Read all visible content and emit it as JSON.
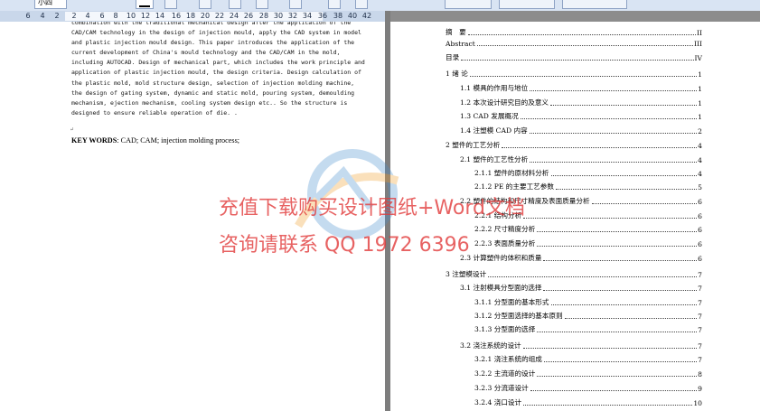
{
  "toolbar": {
    "font_size": "小四"
  },
  "ruler": {
    "ticks": [
      "6",
      "4",
      "2",
      "2",
      "4",
      "6",
      "8",
      "10",
      "12",
      "14",
      "16",
      "18",
      "20",
      "22",
      "24",
      "26",
      "28",
      "30",
      "32",
      "34",
      "36",
      "38",
      "40",
      "42"
    ]
  },
  "abstract_lines": [
    "combination with the traditional mechanical design after the application of the",
    "CAD/CAM technology in the design of injection mould, apply the CAD system in model",
    "and plastic injection mould design. This paper introduces the application of the",
    "current development of China's mould technology and the CAD/CAM in the mold,",
    "including AUTOCAD. Design of mechanical part, which includes the work principle and",
    "application of plastic injection mould, the design criteria. Design calculation of",
    "the plastic mold, mold structure design, selection of injection molding machine,",
    "the design of gating system, dynamic and static mold, pouring system, demoulding",
    "mechanism, ejection mechanism, cooling system design etc.. So the structure is",
    "designed to ensure reliable operation of die. ."
  ],
  "keywords": {
    "label": "KEY WORDS",
    "text": ": CAD; CAM; injection molding process;"
  },
  "toc": [
    {
      "label": "摘　要",
      "page": "II"
    },
    {
      "label": "Abstract",
      "page": "III"
    },
    {
      "label": "目录",
      "page": "IV"
    },
    {
      "label": "1  绪  论",
      "page": "1"
    },
    {
      "label": "1.1 模具的作用与地位",
      "page": "1"
    },
    {
      "label": "1.2  本次设计研究目的及意义",
      "page": "1"
    },
    {
      "label": "1.3 CAD 发展概况",
      "page": "1"
    },
    {
      "label": "1.4  注塑模 CAD 内容",
      "page": "2"
    },
    {
      "label": "2  塑件的工艺分析",
      "page": "4"
    },
    {
      "label": "2.1 塑件的工艺性分析",
      "page": "4"
    },
    {
      "label": "2.1.1  塑件的原材料分析",
      "page": "4"
    },
    {
      "label": "2.1.2 PE 的主要工艺参数",
      "page": "5"
    },
    {
      "label": "2.2 塑件的结构和尺寸精度及表面质量分析",
      "page": "6"
    },
    {
      "label": "2.2.1  结构分析",
      "page": "6"
    },
    {
      "label": "2.2.2  尺寸精度分析",
      "page": "6"
    },
    {
      "label": "2.2.3 表面质量分析",
      "page": "6"
    },
    {
      "label": "2.3 计算塑件的体积和质量",
      "page": "6"
    },
    {
      "label": "3 注塑模设计",
      "page": "7"
    },
    {
      "label": "3.1  注射模具分型面的选择",
      "page": "7"
    },
    {
      "label": "3.1.1  分型面的基本形式",
      "page": "7"
    },
    {
      "label": "3.1.2  分型面选择的基本原则",
      "page": "7"
    },
    {
      "label": "3.1.3  分型面的选择",
      "page": "7"
    },
    {
      "label": "3.2  浇注系统的设计",
      "page": "7"
    },
    {
      "label": "3.2.1  浇注系统的组成",
      "page": "7"
    },
    {
      "label": "3.2.2    主流道的设计",
      "page": "8"
    },
    {
      "label": "3.2.3  分流道设计",
      "page": "9"
    },
    {
      "label": "3.2.4  浇口设计",
      "page": "10"
    }
  ],
  "watermark": {
    "line1": "充值下载购买设计图纸+Word文档",
    "line2": "咨询请联系  QQ 1972 6396",
    "color": "#e23b3b"
  }
}
